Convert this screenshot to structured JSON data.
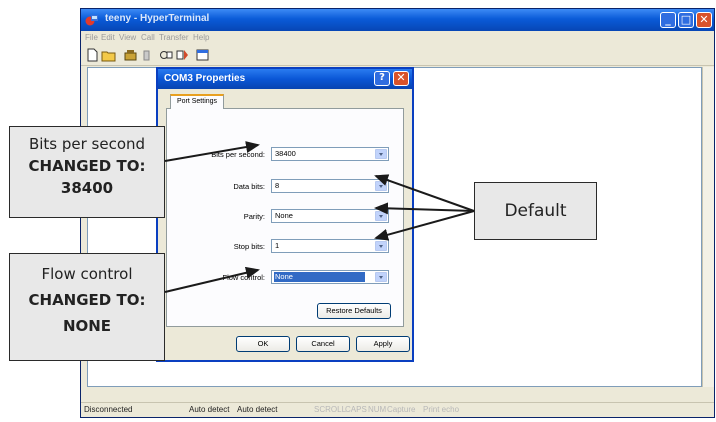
{
  "window": {
    "title": "teeny - HyperTerminal",
    "menu": [
      "File",
      "Edit",
      "View",
      "Call",
      "Transfer",
      "Help"
    ],
    "controls": {
      "minimize": "_",
      "maximize": "□",
      "close": "✕"
    }
  },
  "status_bar": [
    "Disconnected",
    "Auto detect",
    "Auto detect",
    "SCROLL",
    "CAPS",
    "NUM",
    "Capture",
    "Print echo"
  ],
  "dialog": {
    "title": "COM3 Properties",
    "help": "?",
    "close": "✕",
    "tab": "Port Settings",
    "fields": [
      {
        "label": "Bits per second:",
        "value": "38400"
      },
      {
        "label": "Data bits:",
        "value": "8"
      },
      {
        "label": "Parity:",
        "value": "None"
      },
      {
        "label": "Stop bits:",
        "value": "1"
      },
      {
        "label": "Flow control:",
        "value": "None"
      }
    ],
    "restore_defaults": "Restore Defaults",
    "ok": "OK",
    "cancel": "Cancel",
    "apply": "Apply"
  },
  "annotations": {
    "bits": {
      "line1": "Bits per second",
      "line2": "CHANGED TO:",
      "line3": "38400"
    },
    "flow": {
      "line1": "Flow control",
      "line2": "CHANGED TO:",
      "line3": "NONE"
    },
    "default": "Default"
  },
  "colors": {
    "titlebar_blue": "#0a5bd8",
    "dialog_border": "#0a3fc0",
    "selection": "#316ac5",
    "callout_fill": "#e8e8e8"
  }
}
